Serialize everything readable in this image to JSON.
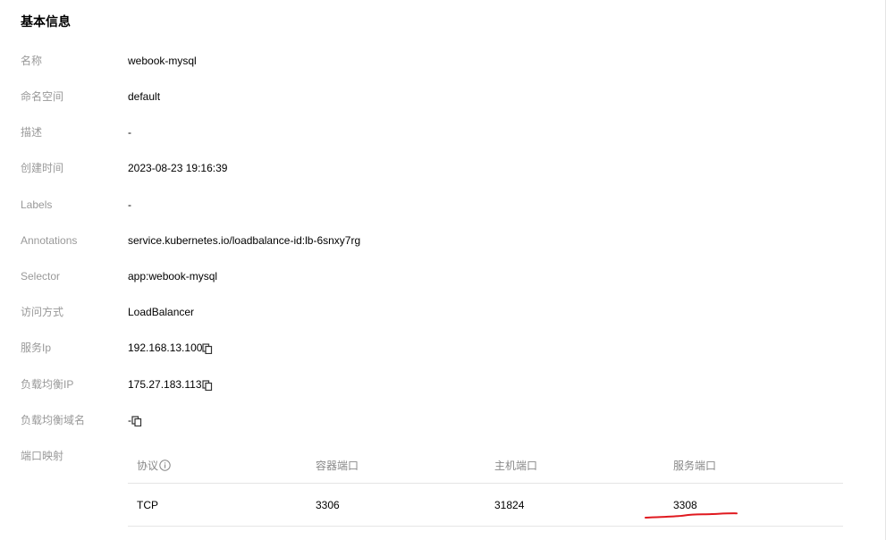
{
  "section": {
    "title": "基本信息"
  },
  "fields": {
    "name": {
      "label": "名称",
      "value": "webook-mysql"
    },
    "namespace": {
      "label": "命名空间",
      "value": "default"
    },
    "description": {
      "label": "描述",
      "value": "-"
    },
    "created_at": {
      "label": "创建时间",
      "value": "2023-08-23 19:16:39"
    },
    "labels": {
      "label": "Labels",
      "value": "-"
    },
    "annotations": {
      "label": "Annotations",
      "value": "service.kubernetes.io/loadbalance-id:lb-6snxy7rg"
    },
    "selector": {
      "label": "Selector",
      "value": "app:webook-mysql"
    },
    "access_mode": {
      "label": "访问方式",
      "value": "LoadBalancer"
    },
    "service_ip": {
      "label": "服务Ip",
      "value": "192.168.13.100"
    },
    "lb_ip": {
      "label": "负载均衡IP",
      "value": "175.27.183.113"
    },
    "lb_domain": {
      "label": "负载均衡域名",
      "value": "-"
    }
  },
  "ports": {
    "label": "端口映射",
    "headers": {
      "protocol": "协议",
      "container_port": "容器端口",
      "host_port": "主机端口",
      "service_port": "服务端口"
    },
    "rows": [
      {
        "protocol": "TCP",
        "container_port": "3306",
        "host_port": "31824",
        "service_port": "3308"
      }
    ]
  },
  "icons": {
    "copy": "copy-icon",
    "info": "info-circle-icon"
  },
  "colors": {
    "label": "#999999",
    "value": "#000000",
    "annotation": "#e0191f"
  }
}
